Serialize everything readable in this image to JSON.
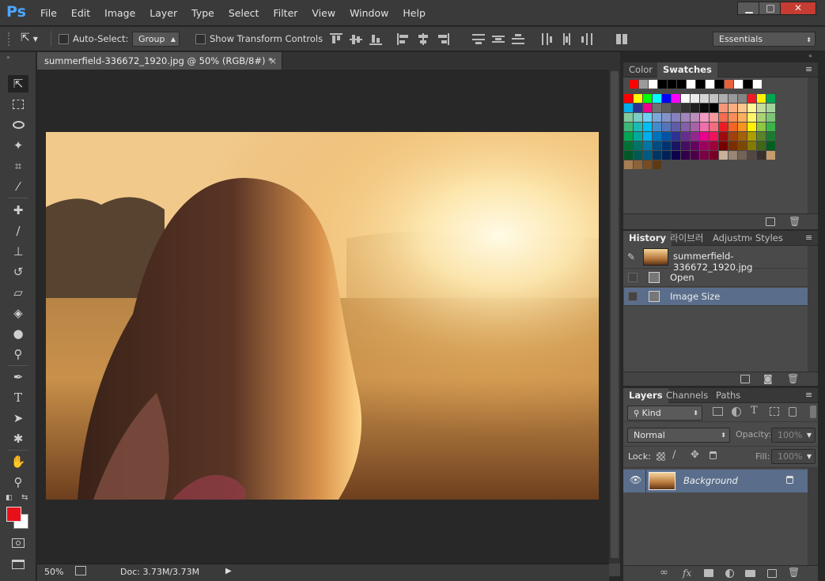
{
  "app": {
    "logo": "Ps",
    "menu": [
      "File",
      "Edit",
      "Image",
      "Layer",
      "Type",
      "Select",
      "Filter",
      "View",
      "Window",
      "Help"
    ],
    "window_controls": {
      "minimize": "▁",
      "maximize": "□",
      "close": "✕"
    }
  },
  "options_bar": {
    "auto_select_label": "Auto-Select:",
    "auto_select_value": "Group",
    "transform_label": "Show Transform Controls",
    "workspace": "Essentials"
  },
  "document": {
    "tab_title": "summerfield-336672_1920.jpg @ 50% (RGB/8#) *",
    "close": "×",
    "zoom": "50%",
    "doc_size": "Doc: 3.73M/3.73M"
  },
  "swatches_panel": {
    "tabs": [
      "Color",
      "Swatches"
    ],
    "active_tab": "Swatches",
    "recent": [
      "#ff0000",
      "#9b9b9b",
      "#ffffff",
      "#000000",
      "#000000",
      "#000000",
      "#ffffff",
      "#000000",
      "#ffffff",
      "#000000",
      "#e8603c",
      "#ffffff",
      "#000000",
      "#ffffff"
    ],
    "rows": [
      [
        "#ff0000",
        "#ffff00",
        "#00ff00",
        "#00ffff",
        "#0000ff",
        "#ff00ff",
        "#ffffff",
        "#ebebeb",
        "#d6d6d6",
        "#c2c2c2",
        "#adadad",
        "#999999",
        "#858585",
        "#ed1c24",
        "#fff200",
        "#00a651"
      ],
      [
        "#00aeef",
        "#2e3192",
        "#ec008c",
        "#707070",
        "#5c5c5c",
        "#474747",
        "#333333",
        "#1f1f1f",
        "#0a0a0a",
        "#000000",
        "#f7977a",
        "#f9ad81",
        "#fdc68a",
        "#fff79a",
        "#c4df9b",
        "#a3d39c"
      ],
      [
        "#82ca9c",
        "#7accc8",
        "#6dcff6",
        "#7da7d9",
        "#8393ca",
        "#8781bd",
        "#a187be",
        "#bc8dbf",
        "#f49ac2",
        "#f6989d",
        "#f26c4f",
        "#f68e56",
        "#fbaf5d",
        "#fff568",
        "#acd373",
        "#7cc576"
      ],
      [
        "#3bb878",
        "#1abbb4",
        "#00bff3",
        "#438ccb",
        "#5574b9",
        "#605ca8",
        "#855fa8",
        "#a763a8",
        "#f06ea9",
        "#f26d7d",
        "#ed1c24",
        "#f26522",
        "#f7941d",
        "#fff200",
        "#8dc63f",
        "#39b54a"
      ],
      [
        "#00a651",
        "#00a99d",
        "#00aeef",
        "#0072bc",
        "#0054a6",
        "#2e3192",
        "#662d91",
        "#92278f",
        "#ec008c",
        "#ed145b",
        "#9e0b0f",
        "#a0410d",
        "#a36209",
        "#aba000",
        "#598527",
        "#1a7b30"
      ],
      [
        "#007236",
        "#00746b",
        "#0076a3",
        "#004b80",
        "#003471",
        "#1b1464",
        "#440e62",
        "#630460",
        "#9e005d",
        "#9e0039",
        "#790000",
        "#7b2e00",
        "#7d4900",
        "#827b00",
        "#406618",
        "#005e20"
      ],
      [
        "#005826",
        "#005952",
        "#005b7f",
        "#003663",
        "#002157",
        "#0d004c",
        "#32004b",
        "#4b0049",
        "#7b0046",
        "#7a0026",
        "#c7b299",
        "#998675",
        "#736357",
        "#534741",
        "#37302d",
        "#c69c6d"
      ],
      [
        "#a67c52",
        "#8c6239",
        "#754c24",
        "#603913"
      ]
    ]
  },
  "history_panel": {
    "tabs": [
      "History",
      "라이브러",
      "Adjustme",
      "Styles"
    ],
    "active_tab": "History",
    "snapshot": "summerfield-336672_1920.jpg",
    "items": [
      "Open",
      "Image Size"
    ],
    "selected": "Image Size"
  },
  "layers_panel": {
    "tabs": [
      "Layers",
      "Channels",
      "Paths"
    ],
    "active_tab": "Layers",
    "filter": "Kind",
    "blend_mode": "Normal",
    "opacity_label": "Opacity:",
    "opacity": "100%",
    "lock_label": "Lock:",
    "fill_label": "Fill:",
    "fill": "100%",
    "layers": [
      {
        "name": "Background",
        "visible": true,
        "locked": true
      }
    ]
  },
  "colors": {
    "foreground": "#e8101a",
    "background": "#ffffff",
    "selection": "#5a6e8c"
  }
}
